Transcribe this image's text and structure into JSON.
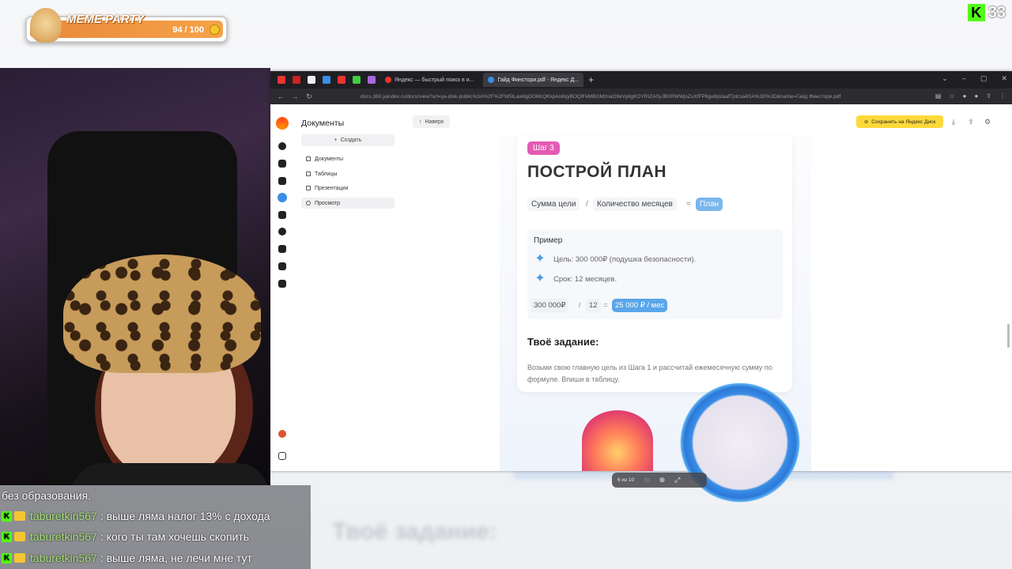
{
  "overlay": {
    "meme_title": "MEME PARTY",
    "meme_count": "94 / 100",
    "kick_letter": "K",
    "kick_count": "33"
  },
  "browser": {
    "tabs": [
      {
        "label": "Яндекс — быстрый поиск в и..."
      },
      {
        "label": "Гайд Финстори.pdf - Яндекс Д..."
      }
    ],
    "new_tab": "+",
    "url": "docs.360.yandex.ru/docs/view?url=ya-disk-public%3A%2F%2FW5lLaw9gDG6KQKkpAo8qyBOQlFkMBGMznaO9eVyitgKOYRIZA0yJBXRWWjsZuXtFP6gwbjstaafTptcsa4SA%3D%3D&name=Гайд Финстори.pdf"
  },
  "sidebar": {
    "title": "Документы",
    "create_label": "Создать",
    "items": [
      {
        "label": "Документы"
      },
      {
        "label": "Таблицы"
      },
      {
        "label": "Презентации"
      },
      {
        "label": "Просмотр"
      }
    ]
  },
  "toolbar": {
    "up_label": "Наверх",
    "save_label": "Сохранить на Яндекс Диск"
  },
  "doc": {
    "step_badge": "Шаг 3",
    "heading": "ПОСТРОЙ ПЛАН",
    "formula": {
      "a": "Сумма цели",
      "op1": "/",
      "b": "Количество месяцев",
      "op2": "=",
      "result": "План"
    },
    "example": {
      "title": "Пример",
      "goal": "Цель: 300 000₽ (подушка безопасности).",
      "term": "Срок: 12 месяцев.",
      "calc_a": "300 000₽",
      "calc_op1": "/",
      "calc_b": "12",
      "calc_op2": "=",
      "calc_result": "25 000 ₽ / мес"
    },
    "task_title": "Твоё задание:",
    "task_text": "Возьми свою главную цель из Шага 1 и рассчитай ежемесячную сумму по формуле. Впиши в таблицу."
  },
  "pager": {
    "label": "6 из 10"
  },
  "chat": {
    "first_line": "без образования.",
    "messages": [
      {
        "user": "taburetkin567",
        "text": ": выше ляма налог 13% с дохода"
      },
      {
        "user": "taburetkin567",
        "text": ": кого ты там хочешь скопить"
      },
      {
        "user": "taburetkin567",
        "text": ": выше ляма, не лечи мне тут"
      }
    ]
  },
  "background_text": "Твоё задание:",
  "colors": {
    "accent_yellow": "#ffd93a",
    "step_pink": "#e55ab4",
    "plan_blue": "#79b6ec",
    "kick_green": "#53fc18"
  }
}
